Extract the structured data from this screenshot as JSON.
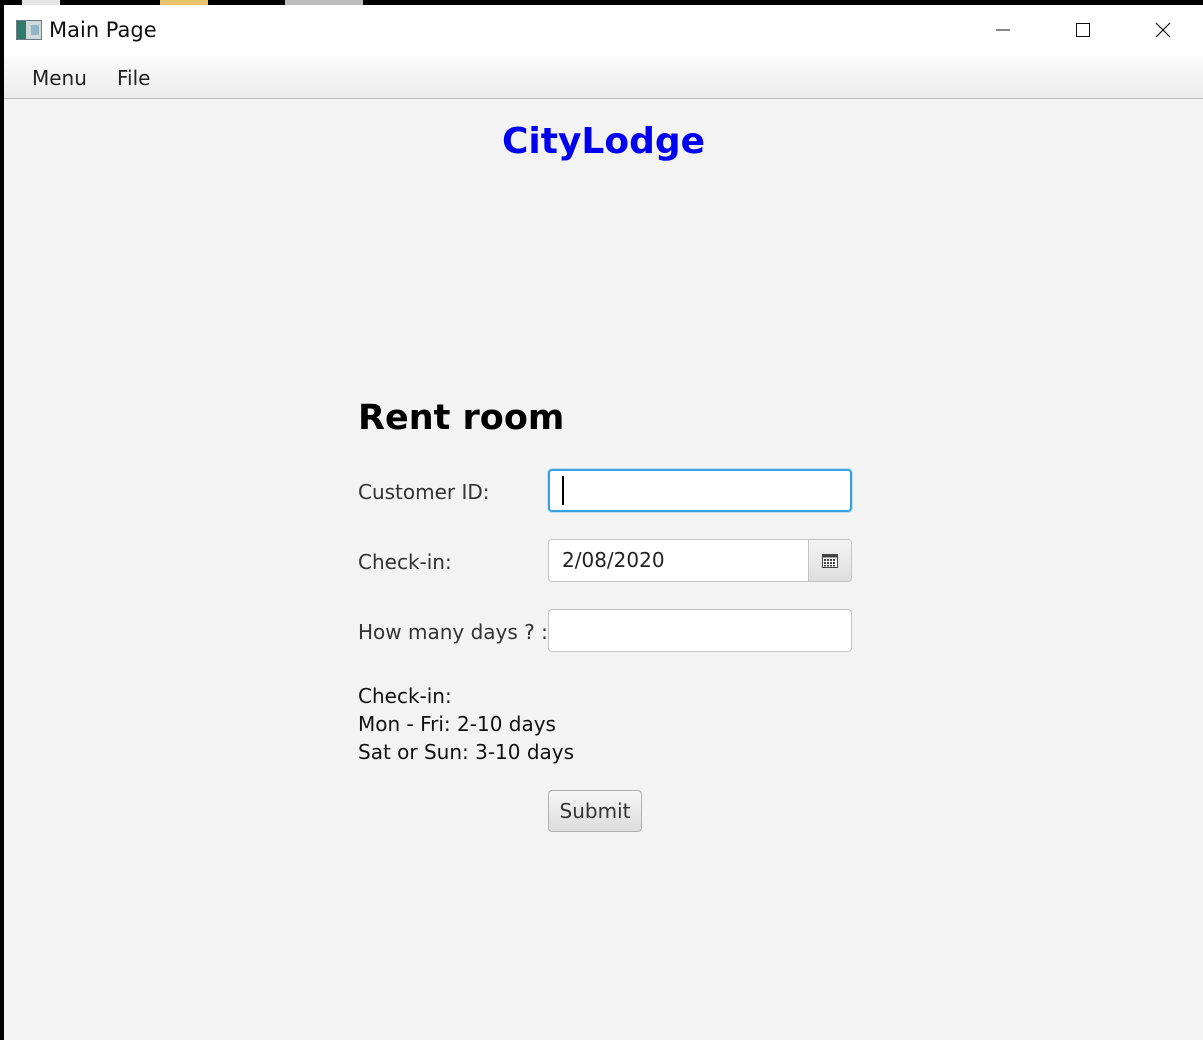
{
  "window": {
    "title": "Main Page",
    "controls": {
      "minimize_icon": "minimize-icon",
      "maximize_icon": "maximize-icon",
      "close_icon": "close-icon"
    }
  },
  "menubar": {
    "items": [
      {
        "label": "Menu"
      },
      {
        "label": "File"
      }
    ]
  },
  "brand": {
    "name": "CityLodge",
    "color": "#0000ee"
  },
  "form": {
    "title": "Rent room",
    "customer_id": {
      "label": "Customer ID:",
      "value": ""
    },
    "check_in": {
      "label": "Check-in:",
      "value": "2/08/2020",
      "icon": "calendar-icon"
    },
    "days": {
      "label": "How many days ? :",
      "value": ""
    },
    "info_lines": [
      "Check-in:",
      "Mon - Fri: 2-10 days",
      "Sat or Sun: 3-10 days"
    ],
    "submit_label": "Submit"
  },
  "colors": {
    "background": "#f3f3f3",
    "focus_ring": "#39a0e0"
  }
}
